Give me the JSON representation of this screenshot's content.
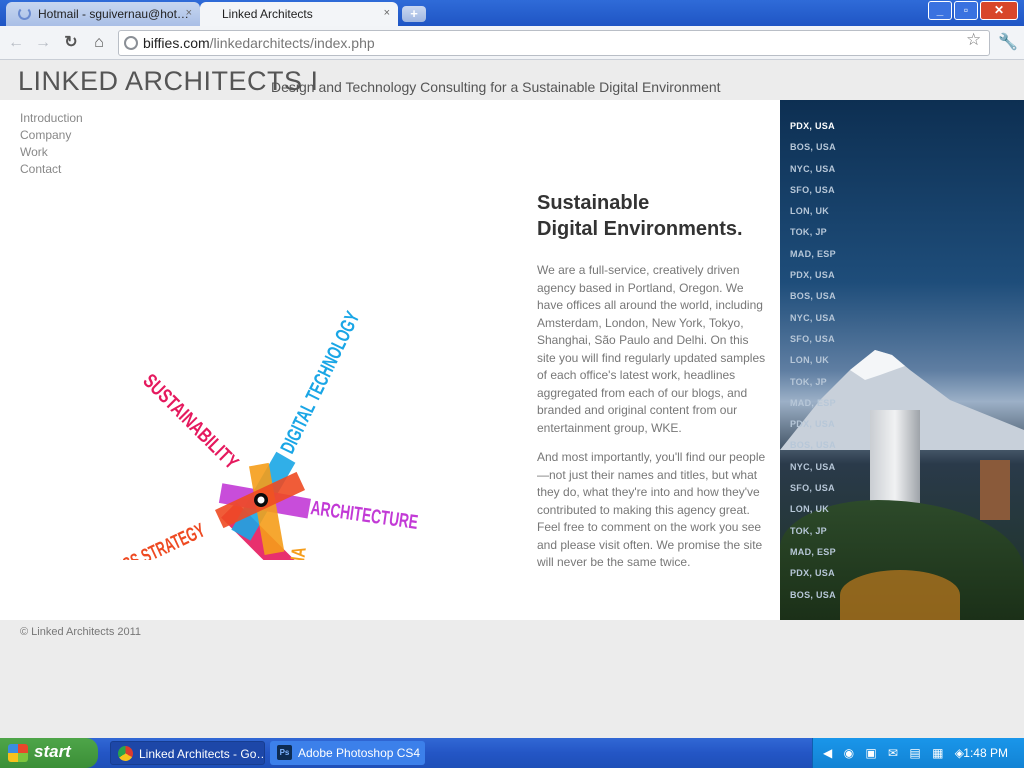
{
  "browser": {
    "tabs": [
      {
        "label": "Hotmail - sguivernau@hot…",
        "close": "×"
      },
      {
        "label": "Linked Architects",
        "close": "×"
      }
    ],
    "new_tab": "+",
    "window_controls": {
      "minimize": "_",
      "maximize": "▫",
      "close": "✕"
    },
    "nav": {
      "back": "←",
      "forward": "→",
      "reload": "↻",
      "home": "⌂"
    },
    "url_host": "biffies.com",
    "url_path": "/linkedarchitects/index.php",
    "star": "☆",
    "wrench": "🔧"
  },
  "site": {
    "title": "LINKED ARCHITECTS I",
    "tagline": "Design and Technology Consulting for a Sustainable Digital Environment",
    "nav": [
      "Introduction",
      "Company",
      "Work",
      "Contact"
    ],
    "hero_labels": {
      "sustainability": "SUSTAINABILITY",
      "digital_technology": "DIGITAL TECHNOLOGY",
      "architecture": "ARCHITECTURE",
      "social_media": "SOCIAL MEDIA",
      "business_strategy": "BUSINESS STRATEGY"
    },
    "hero_colors": {
      "sustainability": "#e5195e",
      "digital_technology": "#1aa6e6",
      "architecture": "#c23ad6",
      "social_media": "#f59d1a",
      "business_strategy": "#ee4a22"
    },
    "article": {
      "heading_line1": "Sustainable",
      "heading_line2": "Digital Environments.",
      "p1": "We are a full-service, creatively driven agency based in Portland, Oregon. We have offices all around the world, including Amsterdam, London, New York, Tokyo, Shanghai, São Paulo and Delhi. On this site you will find regularly updated samples of each office's latest work, headlines aggregated from each of our blogs, and branded and original content from our entertainment group, WKE.",
      "p2": "And most importantly, you'll find our people—not just their names and titles, but what they do, what they're into and how they've contributed to making this agency great. Feel free to comment on the work you see and please visit often. We promise the site will never be the same twice."
    },
    "cities": [
      "PDX, USA",
      "BOS, USA",
      "NYC, USA",
      "SFO, USA",
      "LON, UK",
      "TOK, JP",
      "MAD, ESP",
      "PDX, USA",
      "BOS, USA",
      "NYC, USA",
      "SFO, USA",
      "LON, UK",
      "TOK, JP",
      "MAD, ESP",
      "PDX, USA",
      "BOS, USA",
      "NYC, USA",
      "SFO, USA",
      "LON, UK",
      "TOK, JP",
      "MAD, ESP",
      "PDX, USA",
      "BOS, USA"
    ],
    "footer": "© Linked Architects 2011"
  },
  "taskbar": {
    "start": "start",
    "tasks": [
      "Linked Architects - Go…",
      "Adobe Photoshop CS4"
    ],
    "ps_icon": "Ps",
    "clock": "1:48 PM"
  }
}
